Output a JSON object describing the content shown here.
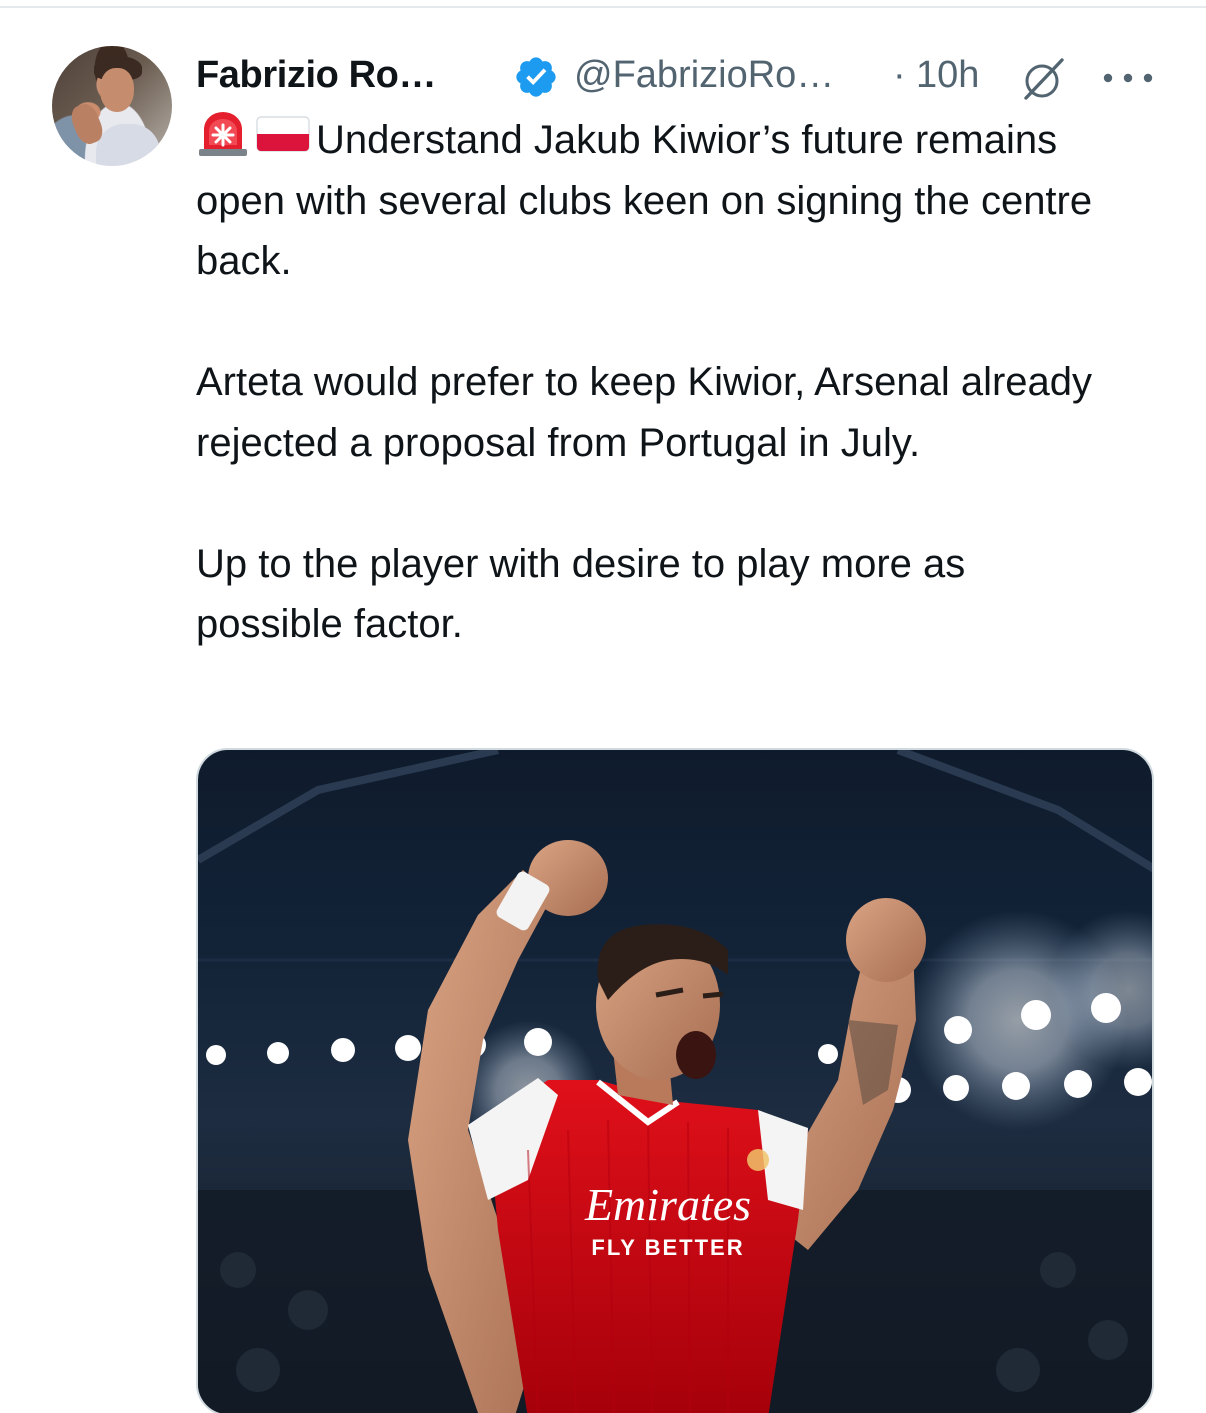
{
  "tweet": {
    "author_name": "Fabrizio Ro…",
    "author_handle": "@FabrizioRo…",
    "separator": "·",
    "timestamp": "10h",
    "paragraphs": [
      "Understand Jakub Kiwior’s future remains open with several clubs keen on signing the centre back.",
      "Arteta would prefer to keep Kiwior, Arsenal already rejected a proposal from Portugal in July.",
      "Up to the player with desire to play more as possible factor."
    ],
    "lead_emojis": [
      "rotating-light",
      "flag-poland"
    ],
    "media": {
      "type": "photo",
      "shirt_sponsor_line1": "Emirates",
      "shirt_sponsor_line2": "FLY BETTER"
    }
  },
  "icons": {
    "verified": "verified-badge-icon",
    "grok": "grok-icon",
    "more": "more-options-icon"
  },
  "colors": {
    "text_primary": "#0f1419",
    "text_secondary": "#536471",
    "verified_blue": "#1d9bf0",
    "border": "#cfd9de",
    "arsenal_red": "#db0007"
  }
}
